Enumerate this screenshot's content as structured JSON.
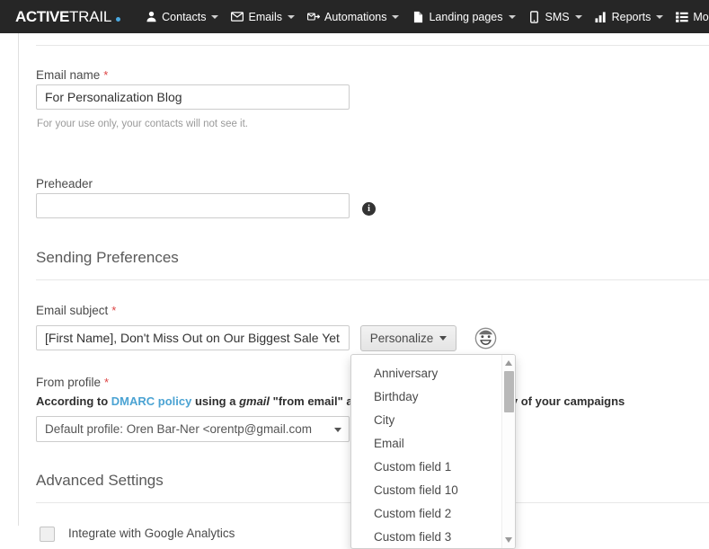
{
  "topbar": {
    "logo": {
      "bold": "ACTIVE",
      "light": "TRAIL"
    },
    "nav": [
      {
        "label": "Contacts",
        "icon": "person-icon"
      },
      {
        "label": "Emails",
        "icon": "envelope-icon"
      },
      {
        "label": "Automations",
        "icon": "envelope-arrow-icon"
      },
      {
        "label": "Landing pages",
        "icon": "page-icon"
      },
      {
        "label": "SMS",
        "icon": "phone-icon"
      },
      {
        "label": "Reports",
        "icon": "bar-chart-icon"
      },
      {
        "label": "More",
        "icon": "list-icon"
      }
    ]
  },
  "form": {
    "email_name": {
      "label": "Email name",
      "required_mark": "*",
      "value": "For Personalization Blog",
      "helper": "For your use only, your contacts will not see it."
    },
    "preheader": {
      "label": "Preheader",
      "value": "",
      "placeholder": "",
      "info_glyph": "i"
    },
    "sending_preferences_title": "Sending Preferences",
    "email_subject": {
      "label": "Email subject",
      "required_mark": "*",
      "value": "[First Name], Don't Miss Out on Our Biggest Sale Yet"
    },
    "personalize_button": "Personalize",
    "from_profile": {
      "label": "From profile",
      "required_mark": "*",
      "selected": "Default profile: Oren Bar-Ner <orentp@gmail.com"
    },
    "dmarc_notice": {
      "prefix": "According to ",
      "link": "DMARC policy",
      "mid": " using a ",
      "emphasis": "gmail",
      "suffix": " \"from email\" address may harm the delivery of your campaigns"
    },
    "advanced_settings_title": "Advanced Settings",
    "google_analytics": {
      "label": "Integrate with Google Analytics",
      "checked": false
    }
  },
  "personalize_dropdown": {
    "items": [
      "Anniversary",
      "Birthday",
      "City",
      "Email",
      "Custom field 1",
      "Custom field 10",
      "Custom field 2",
      "Custom field 3"
    ]
  },
  "colors": {
    "topbar_bg": "#262626",
    "accent_blue": "#4aa8e0",
    "link_blue": "#4ba3d3",
    "required_red": "#dd4444"
  }
}
